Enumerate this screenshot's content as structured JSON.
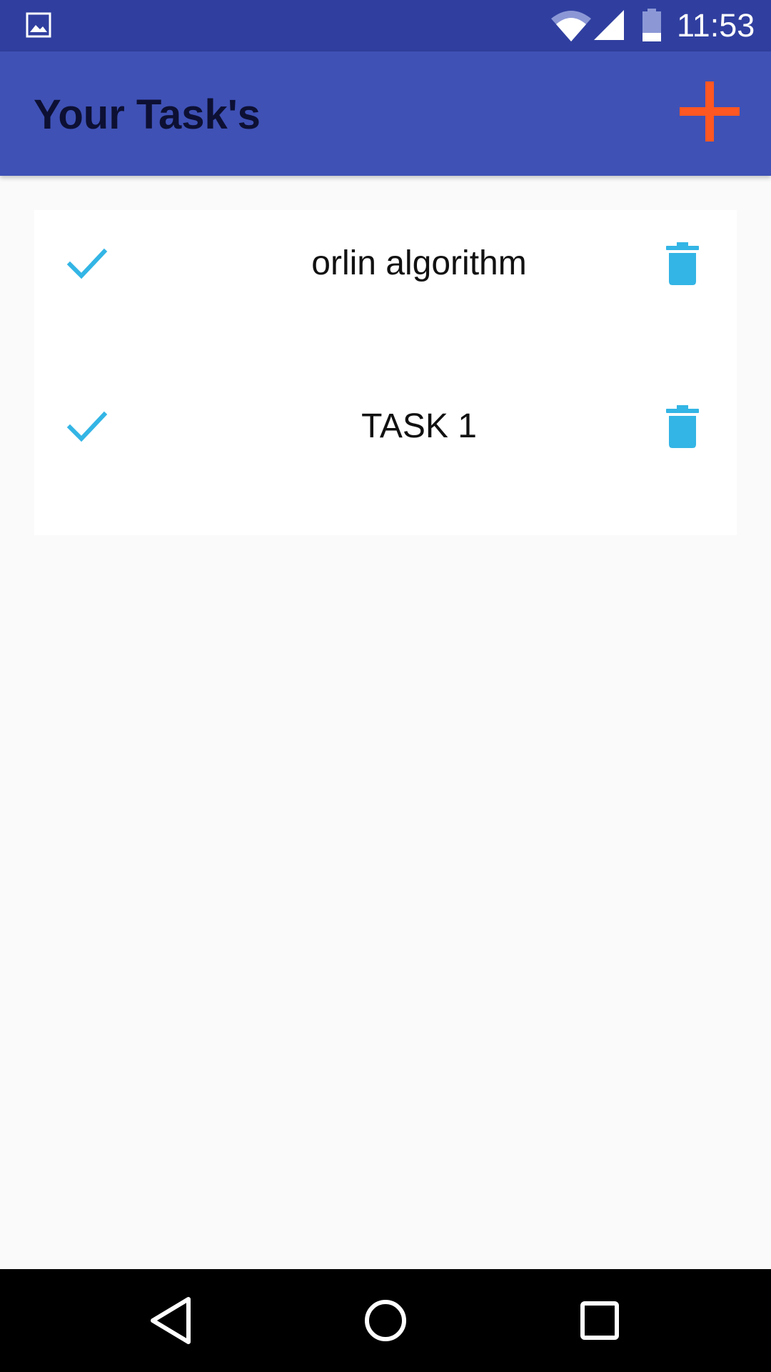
{
  "status_bar": {
    "time": "11:53",
    "icons": [
      "gallery-notification-icon",
      "wifi-icon",
      "cell-signal-icon",
      "battery-icon"
    ]
  },
  "app_bar": {
    "title": "Your Task's",
    "add_icon": "plus-icon",
    "add_icon_color": "#ff5722"
  },
  "tasks": [
    {
      "title": "orlin algorithm",
      "done_icon": "check-icon",
      "delete_icon": "trash-icon"
    },
    {
      "title": "TASK 1",
      "done_icon": "check-icon",
      "delete_icon": "trash-icon"
    }
  ],
  "colors": {
    "status_bar": "#303f9f",
    "app_bar": "#3f51b5",
    "accent_icons": "#33b5e5",
    "add_button": "#ff5722",
    "background": "#fafafa",
    "nav_bar": "#000000"
  },
  "nav_bar": {
    "icons": [
      "back-icon",
      "home-icon",
      "recents-icon"
    ]
  }
}
